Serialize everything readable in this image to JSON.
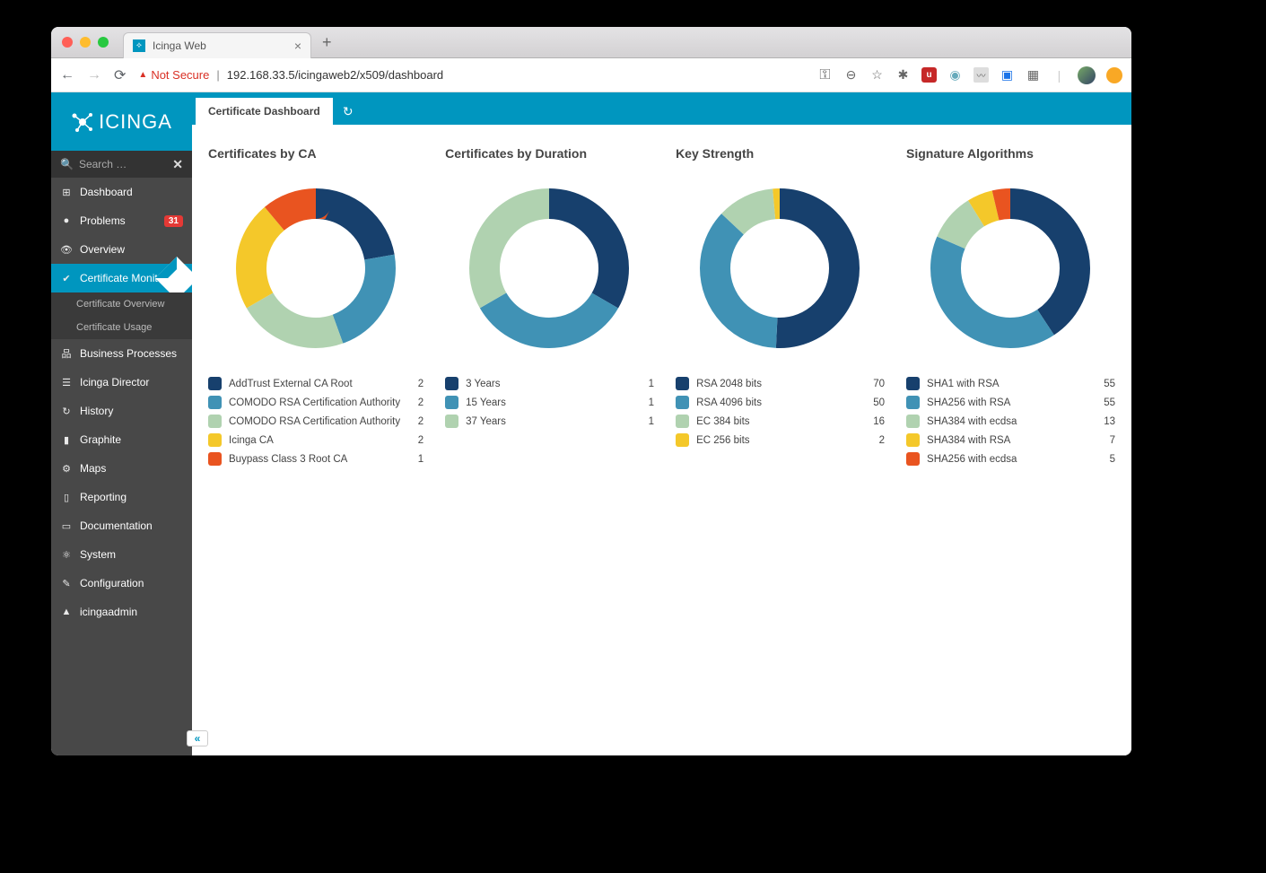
{
  "browser": {
    "tab_title": "Icinga Web",
    "not_secure_label": "Not Secure",
    "url": "192.168.33.5/icingaweb2/x509/dashboard"
  },
  "sidebar": {
    "logo_text": "ICINGA",
    "search_placeholder": "Search …",
    "items": [
      {
        "icon": "⊞",
        "label": "Dashboard"
      },
      {
        "icon": "●",
        "label": "Problems",
        "badge": "31"
      },
      {
        "icon": "👁",
        "label": "Overview"
      },
      {
        "icon": "✔",
        "label": "Certificate Monitoring",
        "active": true
      },
      {
        "sub": true,
        "label": "Certificate Overview"
      },
      {
        "sub": true,
        "label": "Certificate Usage"
      },
      {
        "icon": "品",
        "label": "Business Processes"
      },
      {
        "icon": "☰",
        "label": "Icinga Director"
      },
      {
        "icon": "↻",
        "label": "History"
      },
      {
        "icon": "▮",
        "label": "Graphite"
      },
      {
        "icon": "⚙",
        "label": "Maps"
      },
      {
        "icon": "▯",
        "label": "Reporting"
      },
      {
        "icon": "▭",
        "label": "Documentation"
      },
      {
        "icon": "⚛",
        "label": "System"
      },
      {
        "icon": "✎",
        "label": "Configuration"
      },
      {
        "icon": "▲",
        "label": "icingaadmin"
      }
    ]
  },
  "topbar": {
    "tab_label": "Certificate Dashboard"
  },
  "colors": {
    "c1": "#17406d",
    "c2": "#4092b5",
    "c3": "#b0d2b0",
    "c4": "#f4c82a",
    "c5": "#e95420"
  },
  "chart_data": [
    {
      "type": "donut",
      "title": "Certificates by CA",
      "series": [
        {
          "name": "AddTrust External CA Root",
          "value": 2,
          "color": "c1"
        },
        {
          "name": "COMODO RSA Certification Authority",
          "value": 2,
          "color": "c2"
        },
        {
          "name": "COMODO RSA Certification Authority",
          "value": 2,
          "color": "c3"
        },
        {
          "name": "Icinga CA",
          "value": 2,
          "color": "c4"
        },
        {
          "name": "Buypass Class 3 Root CA",
          "value": 1,
          "color": "c5"
        }
      ]
    },
    {
      "type": "donut",
      "title": "Certificates by Duration",
      "series": [
        {
          "name": "3 Years",
          "value": 1,
          "color": "c1"
        },
        {
          "name": "15 Years",
          "value": 1,
          "color": "c2"
        },
        {
          "name": "37 Years",
          "value": 1,
          "color": "c3"
        }
      ]
    },
    {
      "type": "donut",
      "title": "Key Strength",
      "series": [
        {
          "name": "RSA 2048 bits",
          "value": 70,
          "color": "c1"
        },
        {
          "name": "RSA 4096 bits",
          "value": 50,
          "color": "c2"
        },
        {
          "name": "EC 384 bits",
          "value": 16,
          "color": "c3"
        },
        {
          "name": "EC 256 bits",
          "value": 2,
          "color": "c4"
        }
      ]
    },
    {
      "type": "donut",
      "title": "Signature Algorithms",
      "series": [
        {
          "name": "SHA1 with RSA",
          "value": 55,
          "color": "c1"
        },
        {
          "name": "SHA256 with RSA",
          "value": 55,
          "color": "c2"
        },
        {
          "name": "SHA384 with ecdsa",
          "value": 13,
          "color": "c3"
        },
        {
          "name": "SHA384 with RSA",
          "value": 7,
          "color": "c4"
        },
        {
          "name": "SHA256 with ecdsa",
          "value": 5,
          "color": "c5"
        }
      ]
    }
  ]
}
